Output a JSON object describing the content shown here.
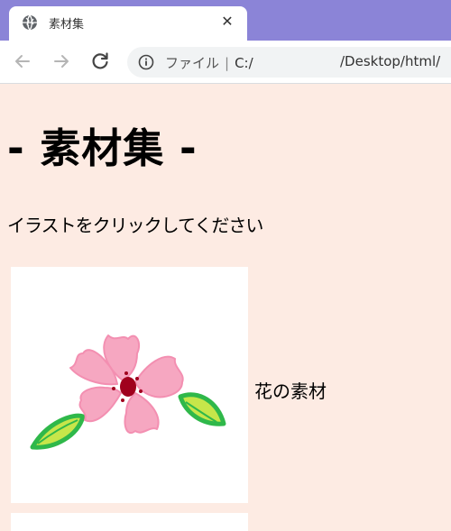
{
  "browser": {
    "tab": {
      "title": "素材集",
      "close_glyph": "✕"
    },
    "toolbar": {
      "back_icon": "arrow-left-icon",
      "forward_icon": "arrow-right-icon",
      "reload_icon": "reload-icon",
      "security_label": "ファイル",
      "separator": "|",
      "url_prefix": "C:/",
      "url_path": "/Desktop/html/"
    }
  },
  "page": {
    "title": "- 素材集 -",
    "instruction": "イラストをクリックしてください",
    "items": [
      {
        "caption": "花の素材",
        "image": "flower-illustration"
      }
    ]
  },
  "colors": {
    "tabbar": "#8b84d7",
    "page_background": "#fdebe3",
    "petal": "#f6a7c1",
    "leaf": "#2fb84a"
  }
}
